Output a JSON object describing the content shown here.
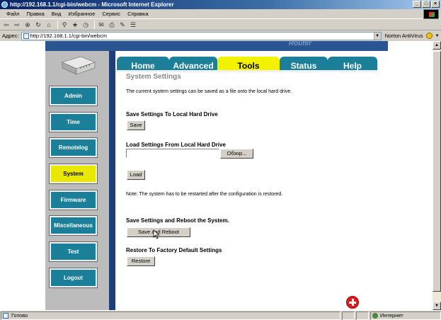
{
  "window": {
    "title": "http://192.168.1.1/cgi-bin/webcm - Microsoft Internet Explorer",
    "buttons": [
      "_",
      "□",
      "×"
    ]
  },
  "menu": [
    "Файл",
    "Правка",
    "Вид",
    "Избранное",
    "Сервис",
    "Справка"
  ],
  "toolbar_icons": [
    "back-icon",
    "forward-icon",
    "stop-icon",
    "refresh-icon",
    "home-icon",
    "search-icon",
    "favorites-icon",
    "history-icon",
    "mail-icon",
    "print-icon",
    "edit-icon",
    "discuss-icon"
  ],
  "address": {
    "label": "Адрес:",
    "value": "http://192.168.1.1/cgi-bin/webcm",
    "toolbar_extra": "Norton AntiVirus"
  },
  "page": {
    "brand": "Router",
    "nav": [
      {
        "label": "Admin",
        "active": false
      },
      {
        "label": "Time",
        "active": false
      },
      {
        "label": "Remotelog",
        "active": false
      },
      {
        "label": "System",
        "active": true
      },
      {
        "label": "Firmware",
        "active": false
      },
      {
        "label": "Miscellaneous",
        "active": false
      },
      {
        "label": "Test",
        "active": false
      },
      {
        "label": "Logout",
        "active": false
      }
    ],
    "tabs": [
      {
        "label": "Home",
        "active": false
      },
      {
        "label": "Advanced",
        "active": false
      },
      {
        "label": "Tools",
        "active": true
      },
      {
        "label": "Status",
        "active": false
      },
      {
        "label": "Help",
        "active": false
      }
    ],
    "section_title": "System Settings",
    "intro": "The current system settings can be saved as a file onto the local hard drive.",
    "save_heading": "Save Settings To Local Hard Drive",
    "save_button": "Save",
    "load_heading": "Load Settings From Local Hard Drive",
    "file_value": "",
    "browse_button": "Обзор...",
    "load_button": "Load",
    "note": "Note: The system has to be restarted after the configuration is restored.",
    "reboot_heading": "Save Settings and Reboot the System.",
    "reboot_button": "Save and Reboot",
    "restore_heading": "Restore To Factory Default Settings",
    "restore_button": "Restore"
  },
  "status": {
    "text": "Готово",
    "zone": "Интернет"
  },
  "colors": {
    "nav_button": "#1c7f99",
    "active_yellow": "#f2f200",
    "frame_blue": "#1c3f7a",
    "panel_gray": "#bcbcbc"
  }
}
